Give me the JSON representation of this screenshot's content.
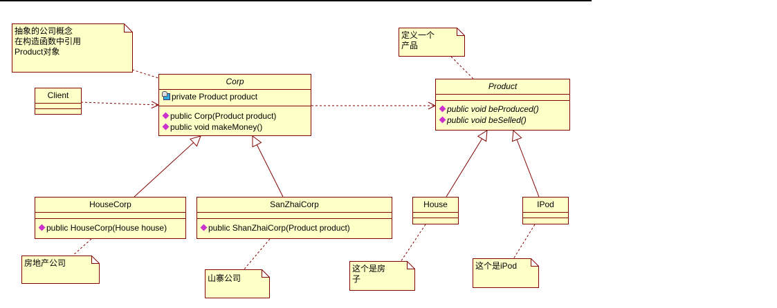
{
  "classes": {
    "client": {
      "name": "Client"
    },
    "corp": {
      "name": "Corp",
      "attributes": [
        "private Product product"
      ],
      "operations": [
        "public Corp(Product product)",
        "public void makeMoney()"
      ]
    },
    "product": {
      "name": "Product",
      "operations": [
        "public void beProduced()",
        "public void beSelled()"
      ]
    },
    "housecorp": {
      "name": "HouseCorp",
      "operations": [
        "public HouseCorp(House house)"
      ]
    },
    "shanzhaicorp": {
      "name": "SanZhaiCorp",
      "operations": [
        "public ShanZhaiCorp(Product product)"
      ]
    },
    "house": {
      "name": "House"
    },
    "ipod": {
      "name": "IPod"
    }
  },
  "notes": {
    "corp_note": "抽象的公司概念\n在构造函数中引用\nProduct对象",
    "product_note": "定义一个\n产品",
    "housecorp_note": "房地产公司",
    "shanzhaicorp_note": "山寨公司",
    "house_note": "这个是房\n子",
    "ipod_note": "这个是iPod"
  },
  "colors": {
    "class_fill": "#ffffc8",
    "border": "#800000",
    "operation_icon": "#cc33cc",
    "attribute_icon": "#33aadd"
  }
}
